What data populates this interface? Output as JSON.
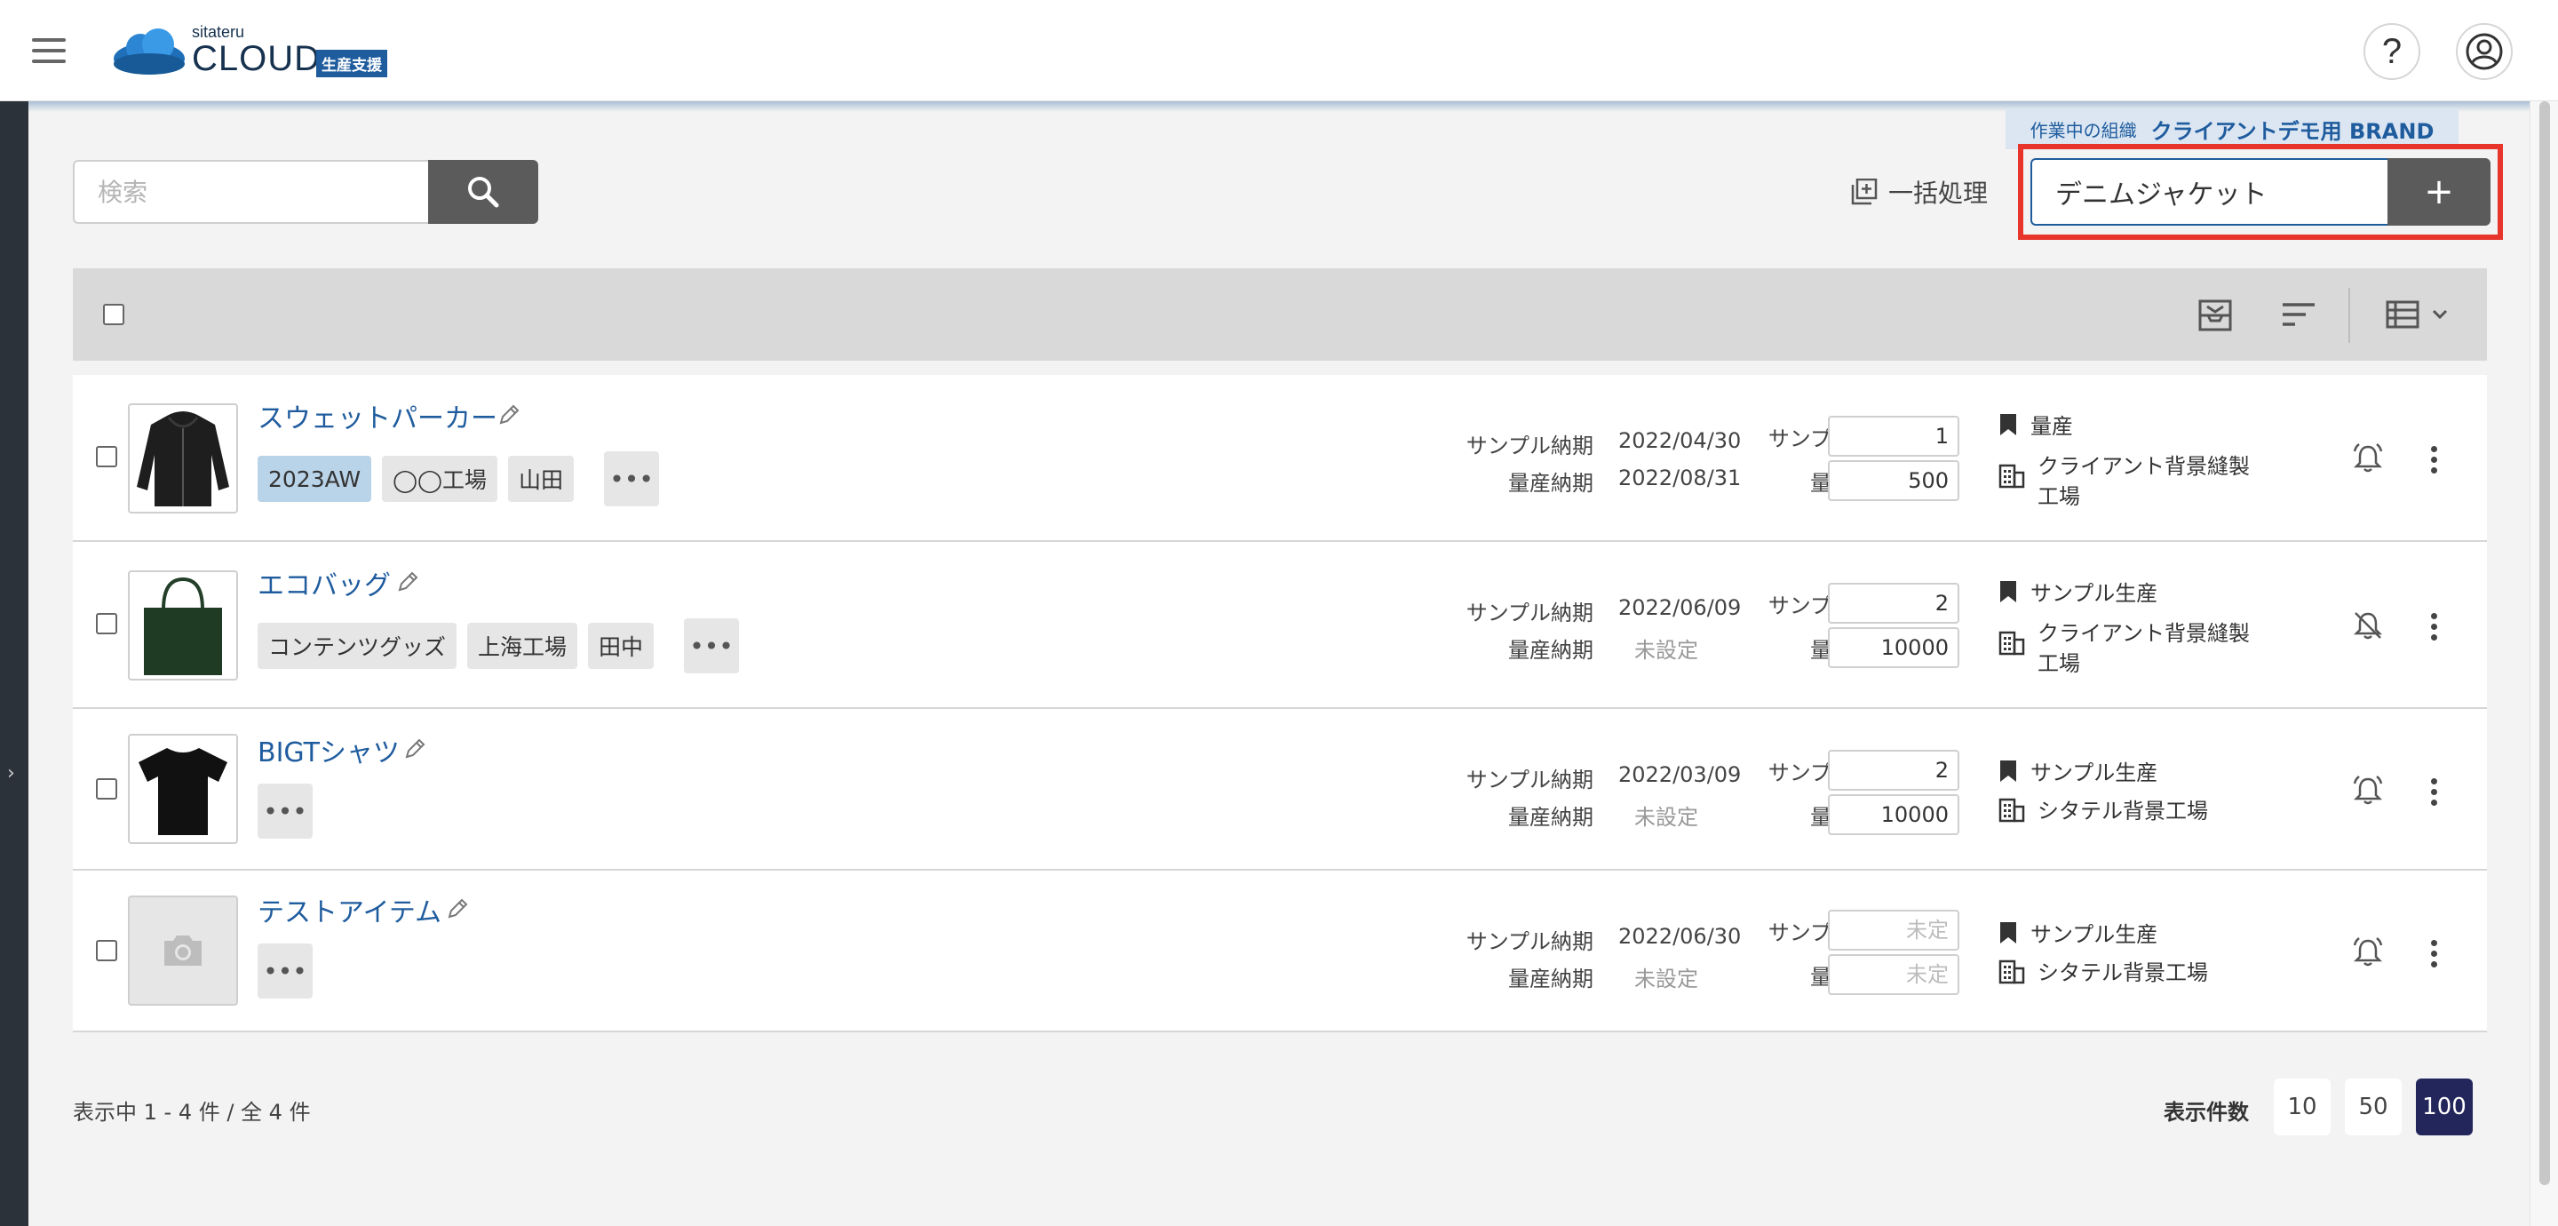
{
  "header": {
    "logo_small": "sitateru",
    "logo_main": "CLOUD",
    "logo_badge": "生産支援",
    "help_label": "?"
  },
  "org": {
    "label": "作業中の組織",
    "name": "クライアントデモ用 BRAND"
  },
  "search": {
    "placeholder": "検索"
  },
  "bulk_action": {
    "label": "一括処理"
  },
  "create": {
    "value": "デニムジャケット",
    "button_label": "+"
  },
  "items": [
    {
      "title": "スウェットパーカー",
      "tags": [
        "2023AW",
        "◯◯工場",
        "山田"
      ],
      "sample_due_label": "サンプル納期",
      "sample_due": "2022/04/30",
      "mass_due_label": "量産納期",
      "mass_due": "2022/08/31",
      "sample_qty_label": "サンプル数量",
      "sample_qty": "1",
      "mass_qty_label": "量産数量",
      "mass_qty": "500",
      "phase": "量産",
      "factory": "クライアント背景縫製工場",
      "notification": "on"
    },
    {
      "title": "エコバッグ",
      "tags": [
        "コンテンツグッズ",
        "上海工場",
        "田中"
      ],
      "sample_due_label": "サンプル納期",
      "sample_due": "2022/06/09",
      "mass_due_label": "量産納期",
      "mass_due": "未設定",
      "sample_qty_label": "サンプル数量",
      "sample_qty": "2",
      "mass_qty_label": "量産数量",
      "mass_qty": "10000",
      "phase": "サンプル生産",
      "factory": "クライアント背景縫製工場",
      "notification": "off"
    },
    {
      "title": "BIGTシャツ",
      "tags": [],
      "sample_due_label": "サンプル納期",
      "sample_due": "2022/03/09",
      "mass_due_label": "量産納期",
      "mass_due": "未設定",
      "sample_qty_label": "サンプル数量",
      "sample_qty": "2",
      "mass_qty_label": "量産数量",
      "mass_qty": "10000",
      "phase": "サンプル生産",
      "factory": "シタテル背景工場",
      "notification": "on"
    },
    {
      "title": "テストアイテム",
      "tags": [],
      "sample_due_label": "サンプル納期",
      "sample_due": "2022/06/30",
      "mass_due_label": "量産納期",
      "mass_due": "未設定",
      "sample_qty_label": "サンプル数量",
      "sample_qty_placeholder": "未定",
      "mass_qty_label": "量産数量",
      "mass_qty_placeholder": "未定",
      "phase": "サンプル生産",
      "factory": "シタテル背景工場",
      "notification": "on"
    }
  ],
  "footer": {
    "count_text": "表示中 1 - 4 件 / 全 4 件",
    "per_page_label": "表示件数",
    "per_page_options": [
      "10",
      "50",
      "100"
    ],
    "per_page_selected": "100"
  },
  "colors": {
    "accent": "#1f5c9e",
    "highlight_frame": "#e8352b",
    "active_page": "#23265a"
  }
}
